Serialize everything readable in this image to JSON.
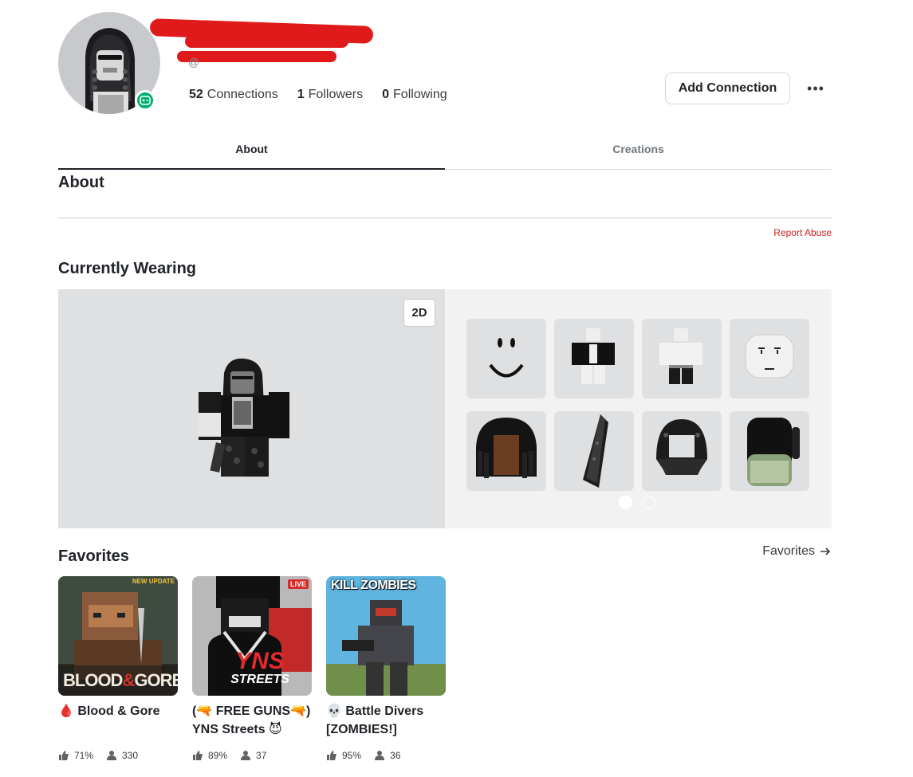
{
  "profile": {
    "handle": "@",
    "stats": [
      {
        "count": "52",
        "label": "Connections"
      },
      {
        "count": "1",
        "label": "Followers"
      },
      {
        "count": "0",
        "label": "Following"
      }
    ],
    "add_connection_label": "Add Connection",
    "more_label": "•••"
  },
  "tabs": [
    {
      "label": "About",
      "active": true
    },
    {
      "label": "Creations",
      "active": false
    }
  ],
  "about": {
    "title": "About",
    "report_label": "Report Abuse"
  },
  "currently_wearing": {
    "title": "Currently Wearing",
    "toggle_label": "2D",
    "items": [
      {
        "icon": "smile-face-icon"
      },
      {
        "icon": "shirt-item-icon"
      },
      {
        "icon": "pants-item-icon"
      },
      {
        "icon": "head-item-icon"
      },
      {
        "icon": "hair-item-icon"
      },
      {
        "icon": "scarf-item-icon"
      },
      {
        "icon": "hood-item-icon"
      },
      {
        "icon": "backpack-item-icon"
      }
    ],
    "page_count": 2,
    "current_page": 1
  },
  "favorites": {
    "title": "Favorites",
    "link_label": "Favorites",
    "games": [
      {
        "name": "🩸 Blood & Gore",
        "rating": "71%",
        "players": "330",
        "badge": "NEW UPDATE",
        "thumb_text_a": "BLOOD",
        "thumb_text_b": "&",
        "thumb_text_c": "GORE"
      },
      {
        "name": "(🔫 FREE GUNS🔫) YNS Streets 😈",
        "rating": "89%",
        "players": "37",
        "badge": "LIVE",
        "thumb_text_a": "YNS",
        "thumb_text_b": "STREETS"
      },
      {
        "name": "💀 Battle Divers [ZOMBIES!]",
        "rating": "95%",
        "players": "36",
        "badge": "KILL ZOMBIES"
      }
    ]
  },
  "colors": {
    "accent_red": "#d11f1f",
    "online_green": "#00b06f",
    "panel_gray": "#dfe0e2"
  }
}
